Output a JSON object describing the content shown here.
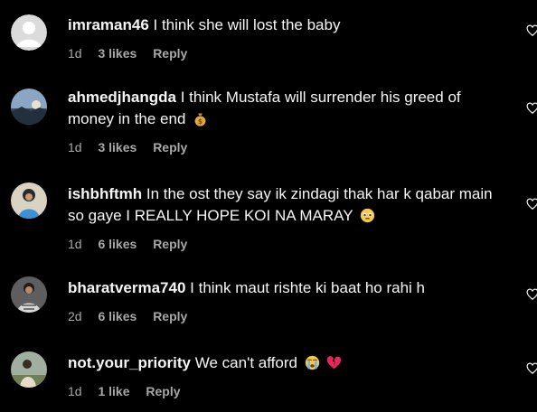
{
  "comments": [
    {
      "username": "imraman46",
      "text": "I think she will lost the baby",
      "time": "1d",
      "likes": "3 likes",
      "reply": "Reply",
      "avatar": "default-avatar",
      "emojis": []
    },
    {
      "username": "ahmedjhangda",
      "text": "I think Mustafa will surrender his greed of money in the end",
      "time": "1d",
      "likes": "3 likes",
      "reply": "Reply",
      "avatar": "sky-photo",
      "emojis": [
        "money-bag-emoji"
      ]
    },
    {
      "username": "ishbhftmh",
      "text": "In the ost they say ik zindagi thak har k qabar main so gaye I REALLY HOPE KOI NA MARAY",
      "time": "1d",
      "likes": "6 likes",
      "reply": "Reply",
      "avatar": "person-blue-photo",
      "emojis": [
        "pleading-face-emoji"
      ]
    },
    {
      "username": "bharatverma740",
      "text": "I think maut rishte ki baat ho rahi h",
      "time": "2d",
      "likes": "6 likes",
      "reply": "Reply",
      "avatar": "person-photo",
      "emojis": []
    },
    {
      "username": "not.your_priority",
      "text": "We can't afford",
      "time": "1d",
      "likes": "1 like",
      "reply": "Reply",
      "avatar": "outdoor-photo",
      "emojis": [
        "crying-face-emoji",
        "broken-heart-emoji"
      ]
    }
  ],
  "colors": {
    "background": "#000000",
    "text": "#f5f5f5",
    "secondary": "#a8a8a8",
    "broken_heart": "#e8245f"
  }
}
